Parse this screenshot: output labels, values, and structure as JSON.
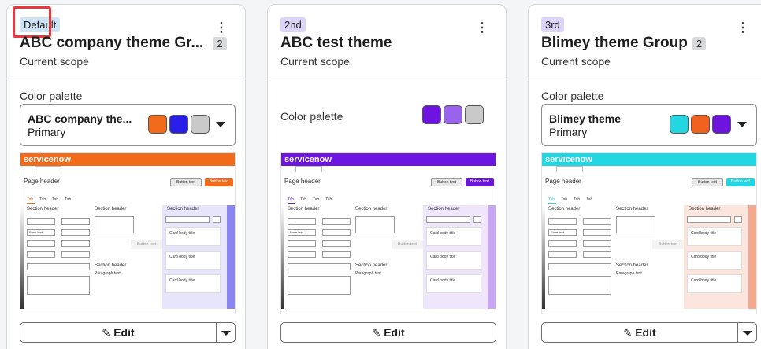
{
  "cards": [
    {
      "badge": "Default",
      "title": "ABC company theme Gr...",
      "count": "2",
      "scope": "Current scope",
      "palette_label": "Color palette",
      "select_name": "ABC company the...",
      "select_sub": "Primary",
      "swatches": [
        "#f26a1b",
        "#2a1fe8",
        "#c9c9c9"
      ],
      "accent": "#f26a1b",
      "strip": "#8a86f0",
      "col3bg": "#e6e5fb",
      "edit": "Edit"
    },
    {
      "badge": "2nd",
      "title": "ABC test theme",
      "scope": "Current scope",
      "palette_label": "Color palette",
      "swatches": [
        "#6d14e0",
        "#9a63ec",
        "#c9c9c9"
      ],
      "accent": "#6d14e0",
      "strip": "#c7a7f2",
      "col3bg": "#efe6fb",
      "edit": "Edit"
    },
    {
      "badge": "3rd",
      "title": "Blimey theme Group",
      "count": "2",
      "scope": "Current scope",
      "palette_label": "Color palette",
      "select_name": "Blimey theme",
      "select_sub": "Primary",
      "swatches": [
        "#22d7e2",
        "#f0601e",
        "#6d14e0"
      ],
      "accent": "#22d7e2",
      "strip": "#f3a98d",
      "col3bg": "#fbe5dc",
      "edit": "Edit"
    }
  ],
  "preview": {
    "brand": "servicenow",
    "page_header": "Page header",
    "button_text": "Button text",
    "tab": "Tab",
    "section_header": "Section header",
    "form_text": "Form text",
    "dots": "...",
    "card_body_title": "Card body title",
    "paragraph_text": "Paragraph text"
  }
}
